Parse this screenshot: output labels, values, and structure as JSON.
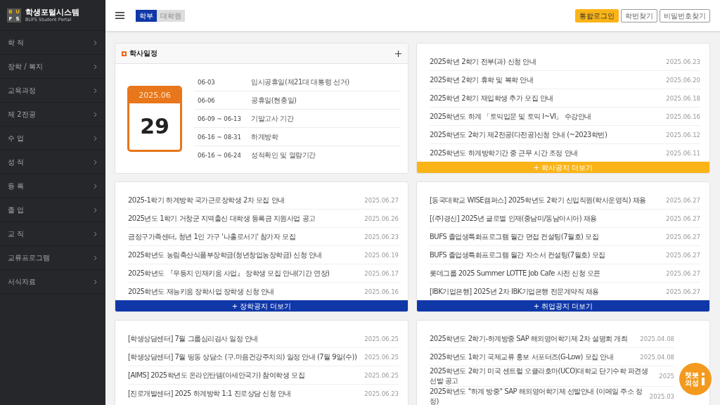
{
  "brand": {
    "logo_letters": [
      "B",
      "U",
      "F",
      "S"
    ],
    "title": "학생포털시스템",
    "subtitle": "BUFS Student Portal"
  },
  "sidebar": {
    "items": [
      {
        "label": "학 적"
      },
      {
        "label": "장학 / 복지"
      },
      {
        "label": "교육과정"
      },
      {
        "label": "제 2전공"
      },
      {
        "label": "수 업"
      },
      {
        "label": "성 적"
      },
      {
        "label": "등 록"
      },
      {
        "label": "졸 업"
      },
      {
        "label": "교 직"
      },
      {
        "label": "교류프로그램"
      },
      {
        "label": "서식자료"
      }
    ]
  },
  "header": {
    "tabs": [
      {
        "label": "학부",
        "selected": true
      },
      {
        "label": "대학원",
        "selected": false
      }
    ],
    "buttons": [
      {
        "label": "통합로그인",
        "kind": "primary"
      },
      {
        "label": "학번찾기",
        "kind": "outline"
      },
      {
        "label": "비밀번호찾기",
        "kind": "outline"
      }
    ]
  },
  "panels": [
    {
      "kind": "calendar",
      "title": "학사일정",
      "month": "2025.06",
      "day": "29",
      "events": [
        {
          "date": "06-03",
          "title": "임시공휴일(제21대 대통령 선거)"
        },
        {
          "date": "06-06",
          "title": "공휴일(현충일)"
        },
        {
          "date": "06-09 ~ 06-13",
          "title": "기말고사 기간"
        },
        {
          "date": "06-16 ~ 08-31",
          "title": "하계방학"
        },
        {
          "date": "06-16 ~ 06-24",
          "title": "성적확인 및 열람기간"
        }
      ]
    },
    {
      "kind": "notices",
      "items": [
        {
          "title": "2025학년 2학기 전부(과) 신청 안내",
          "date": "2025.06.23"
        },
        {
          "title": "2025학년 2학기 휴학 및 복학 안내",
          "date": "2025.06.20"
        },
        {
          "title": "2025학년 2학기 재입학생 추가 모집 안내",
          "date": "2025.06.18"
        },
        {
          "title": "2025학년도 하계 「토익입문 및 토익 Ⅰ~Ⅵ」 수강안내",
          "date": "2025.06.16"
        },
        {
          "title": "2025학년도 2학기 제2전공(다전공)신청 안내 (~2023학번)",
          "date": "2025.06.12"
        },
        {
          "title": "2025학년도 하계방학기간 중 근무 시간 조정 안내",
          "date": "2025.06.11"
        }
      ],
      "more": {
        "label": "+ 학사공지 더보기",
        "color": "#fbb417"
      }
    },
    {
      "kind": "notices",
      "items": [
        {
          "title": "2025-1학기 하계방학 국가근로장학생 2차 모집 안내",
          "date": "2025.06.27"
        },
        {
          "title": "2025년도 1학기 거창군 지역출신 대학생 등록금 지원사업 공고",
          "date": "2025.06.26"
        },
        {
          "title": "금정구가족센터, 청년 1인 가구 '나홀로서기' 참가자 모집",
          "date": "2025.06.23"
        },
        {
          "title": "2025학년도 농림축산식품부장학금(청년창업농장학금) 신청 안내",
          "date": "2025.06.19"
        },
        {
          "title": "2025학년도 『우등지 인재키움 사업』 장학생 모집 안내(기간 연장)",
          "date": "2025.06.17"
        },
        {
          "title": "2025학년도 재능키움 장학사업 장학생 신청 안내",
          "date": "2025.06.16"
        }
      ],
      "more": {
        "label": "+ 장학공지 더보기",
        "color": "#0f37a8"
      }
    },
    {
      "kind": "notices",
      "items": [
        {
          "title": "[동국대학교 WISE캠퍼스] 2025학년도 2학기 신입직원(학사운영직) 채용",
          "date": "2025.06.27"
        },
        {
          "title": "[(주)경신] 2025년 글로벌 인재(중남미/동남아시아) 채용",
          "date": "2025.06.27"
        },
        {
          "title": "BUFS 졸업생특화프로그램 월간 면접 컨설팅(7월호) 모집",
          "date": "2025.06.27"
        },
        {
          "title": "BUFS 졸업생특화프로그램 월간 자소서 컨설팅(7월호) 모집",
          "date": "2025.06.27"
        },
        {
          "title": "롯데그룹 2025 Summer LOTTE Job Cafe 사전 신청 오픈",
          "date": "2025.06.27"
        },
        {
          "title": "[IBK기업은행] 2025년 2차 IBK기업은행 전문계약직 채용",
          "date": "2025.06.27"
        }
      ],
      "more": {
        "label": "+ 취업공지 더보기",
        "color": "#0f37a8"
      }
    },
    {
      "kind": "notices",
      "items": [
        {
          "title": "[학생상담센터] 7월 그룹심리검사 일정 안내",
          "date": "2025.06.25"
        },
        {
          "title": "[학생상담센터] 7월 띵동 상담소 (구.마음건강주치의) 일정 안내 (7월 9일(수))",
          "date": "2025.06.25"
        },
        {
          "title": "[AIMS] 2025학년도 온라인탄뎀(아세안국가) 참여학생 모집",
          "date": "2025.06.25"
        },
        {
          "title": "[진로개발센터] 2025 하계방학 1:1 진로상담 신청 안내",
          "date": "2025.06.23"
        }
      ]
    },
    {
      "kind": "notices",
      "items": [
        {
          "title": "2025학년도 2학기-하계방중 SAP 해외영어학기제 2차 설명회 개최",
          "date": "2025.04.08"
        },
        {
          "title": "2025학년도 1학기 국제교류 홍보 서포터즈(G-Low) 모집 안내",
          "date": "2025.04.08"
        },
        {
          "title": "2025학년도 2학기 미국 센트럴 오클라호마(UCO)대학교 단기수학 파견생 선발 공고",
          "date": "2025"
        },
        {
          "title": "2025학년도 \"하계 방중\" SAP 해외영어학기제 선발안내 (이메일 주소 정정)",
          "date": "2025.03"
        }
      ]
    }
  ],
  "chatbot": {
    "line1": "챗봇",
    "line2": "외성"
  }
}
